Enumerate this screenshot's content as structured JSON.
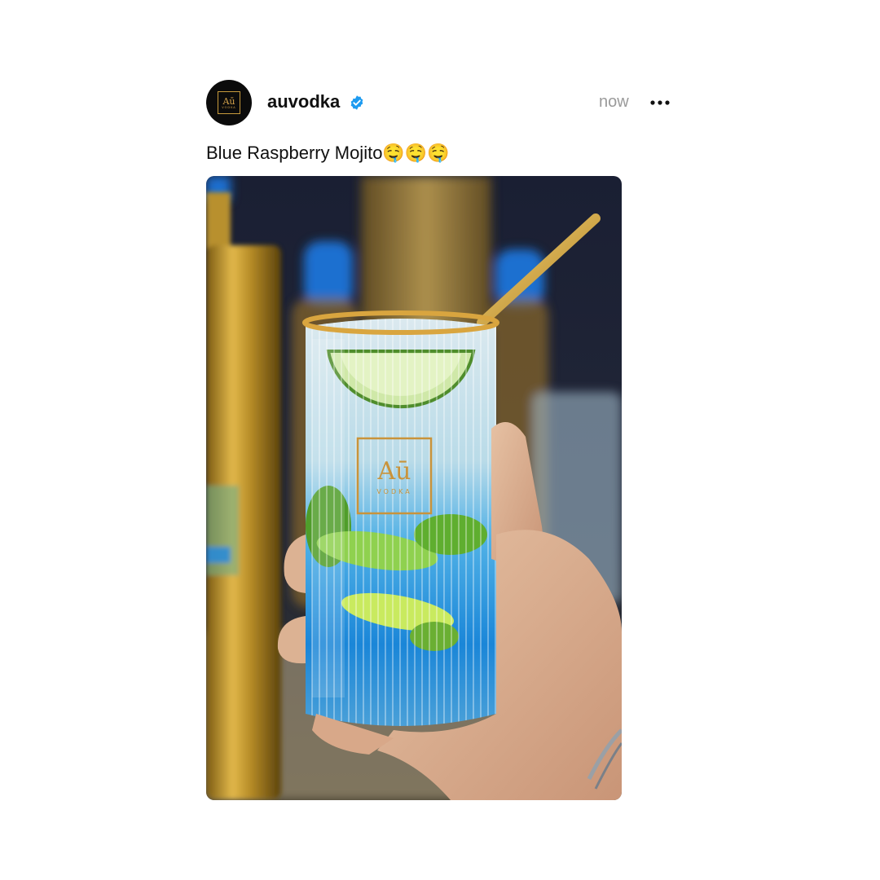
{
  "post": {
    "avatar": {
      "logo_mark": "Aū",
      "logo_sub": "VODKA"
    },
    "username": "auvodka",
    "verified": true,
    "timestamp": "now",
    "caption": "Blue Raspberry Mojito🤤🤤🤤",
    "more_icon": "more-horizontal-icon",
    "media": {
      "description_icon": "photo",
      "glass_logo_mark": "Aū",
      "glass_logo_sub": "VODKA"
    }
  },
  "colors": {
    "verified_blue": "#1d9bf0",
    "gold": "#c99a3a",
    "drink_blue": "#1e88e5",
    "lime": "#8fd14f"
  }
}
